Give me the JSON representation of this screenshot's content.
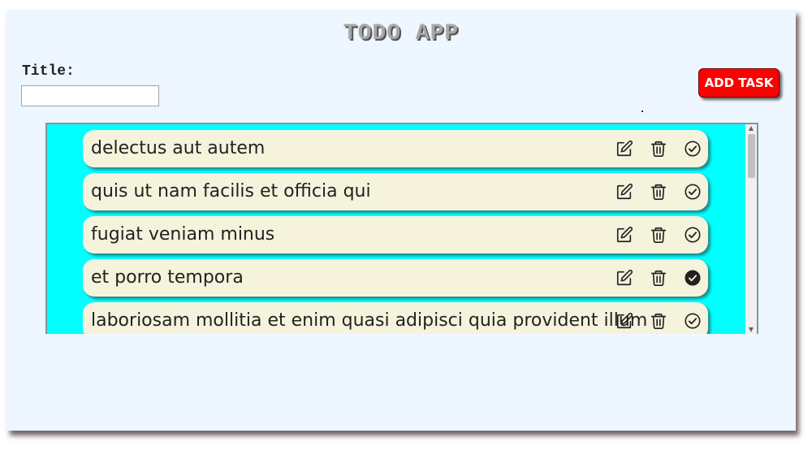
{
  "app": {
    "title": "TODO APP"
  },
  "form": {
    "title_label": "Title:",
    "title_value": "",
    "title_placeholder": "",
    "add_button_label": "ADD TASK"
  },
  "todos": [
    {
      "text": "delectus aut autem",
      "completed": false
    },
    {
      "text": "quis ut nam facilis et officia qui",
      "completed": false
    },
    {
      "text": "fugiat veniam minus",
      "completed": false
    },
    {
      "text": "et porro tempora",
      "completed": true
    },
    {
      "text": "laboriosam mollitia et enim quasi adipisci quia provident illum",
      "completed": false
    }
  ],
  "icons": {
    "edit": "edit-icon",
    "delete": "trash-icon",
    "complete": "check-circle-icon"
  },
  "colors": {
    "background": "#eef6ff",
    "accent_button": "#ff0000",
    "list_background": "#00ffff",
    "item_background": "#f5f3dc"
  }
}
